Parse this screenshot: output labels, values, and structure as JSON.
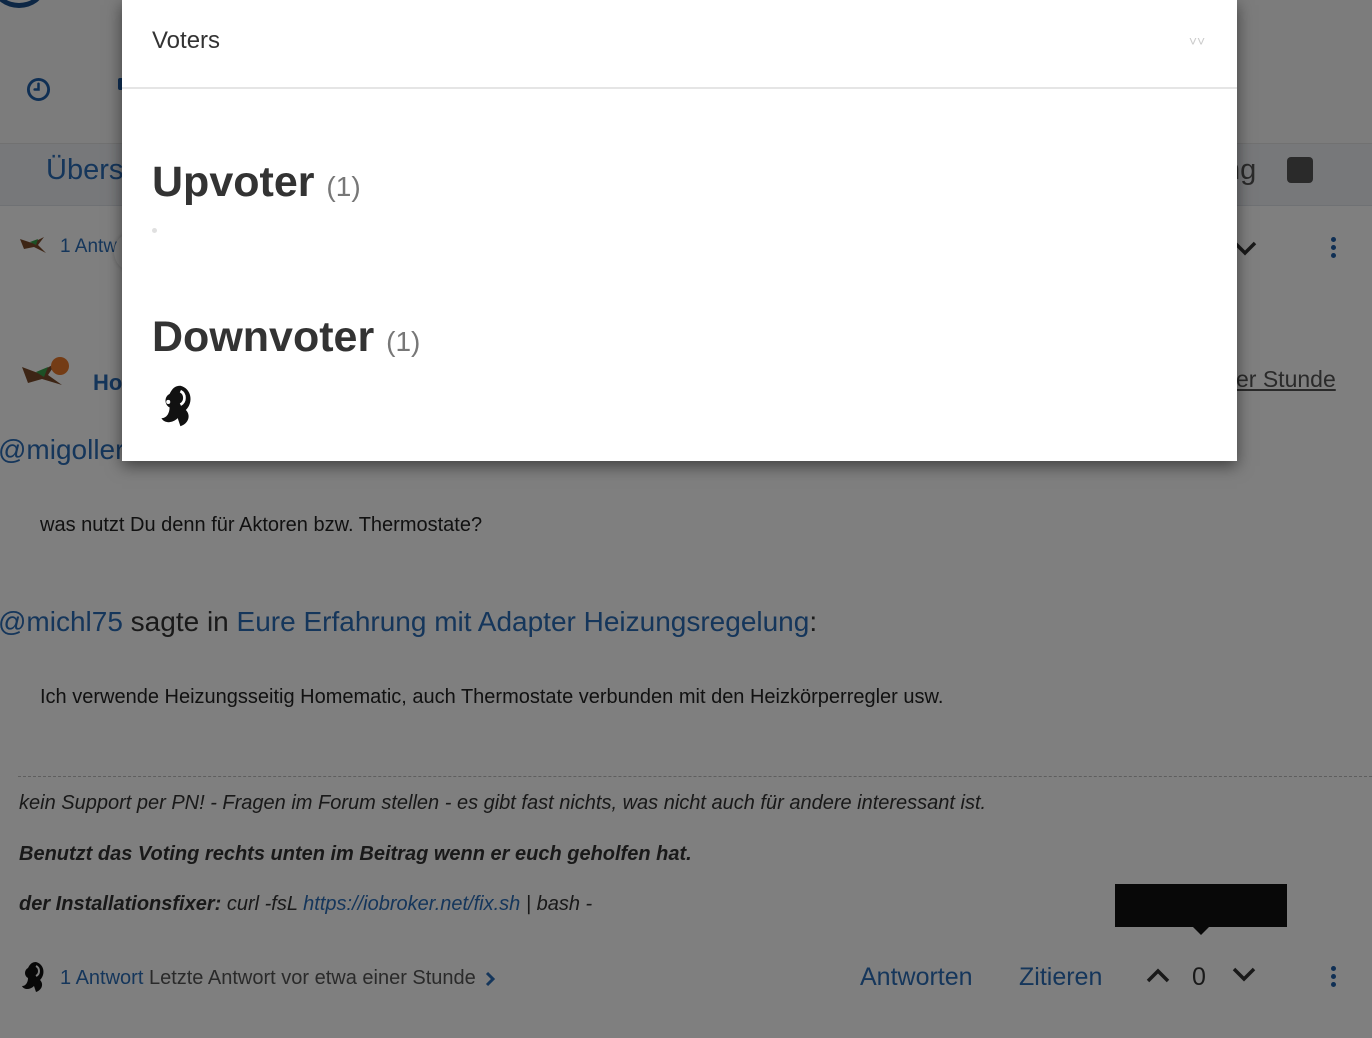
{
  "header": {
    "subnav_left": "Übers",
    "subnav_right": "ng"
  },
  "thread": {
    "reply_link": "1 Antw",
    "author_partial": "Ho",
    "post_time": "er Stunde"
  },
  "post": {
    "quote1": {
      "user": "@migoller",
      "rest": ""
    },
    "text1": "was nutzt Du denn für Aktoren bzw. Thermostate?",
    "quote2": {
      "user": "@michl75",
      "said": " sagte in ",
      "ref": "Eure Erfahrung mit Adapter Heizungsregelung",
      "colon": ":"
    },
    "text2": "Ich verwende Heizungsseitig Homematic, auch Thermostate verbunden mit den Heizkörperregler usw."
  },
  "signature": {
    "line1": "kein Support per PN! - Fragen im Forum stellen - es gibt fast nichts, was nicht auch für andere interessant ist.",
    "line2": "Benutzt das Voting rechts unten im Beitrag wenn er euch geholfen hat.",
    "line3_label": "der Installationsfixer:",
    "line3_cmd": " curl -fsL ",
    "line3_link": "https://iobroker.net/fix.sh",
    "line3_tail": " | bash -"
  },
  "footer": {
    "replies": "1 Antwort",
    "last_reply": " Letzte Antwort vor etwa einer Stunde",
    "reply_button": "Antworten",
    "quote_button": "Zitieren",
    "vote_count": "0"
  },
  "modal": {
    "title": "Voters",
    "close_label": "˅˅",
    "upvoter_heading": "Upvoter",
    "upvoter_count": "(1)",
    "downvoter_heading": "Downvoter",
    "downvoter_count": "(1)"
  },
  "colors": {
    "link": "#2a6cb6",
    "online": "#e8782a",
    "overlay": "rgba(0,0,0,0.5)"
  }
}
